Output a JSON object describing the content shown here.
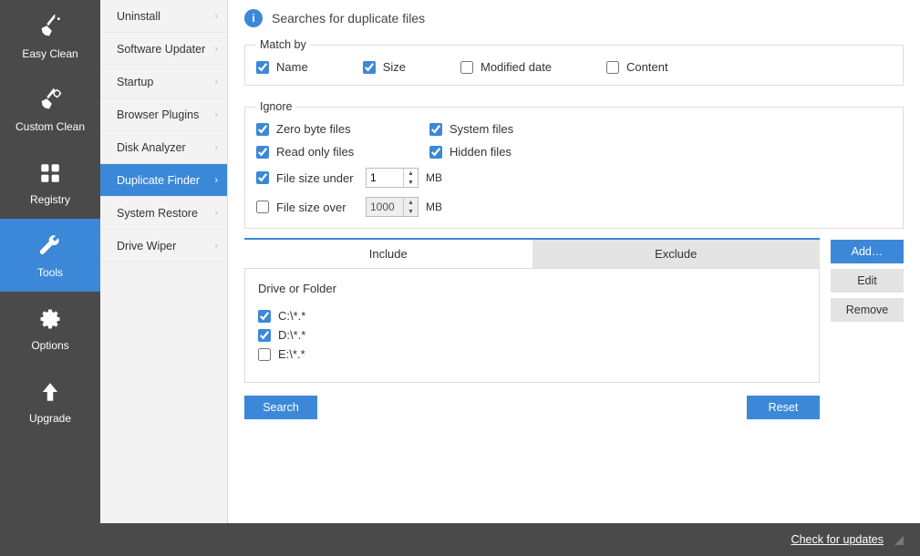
{
  "sidebar_main": {
    "items": [
      {
        "id": "easy-clean",
        "label": "Easy Clean"
      },
      {
        "id": "custom-clean",
        "label": "Custom Clean"
      },
      {
        "id": "registry",
        "label": "Registry"
      },
      {
        "id": "tools",
        "label": "Tools"
      },
      {
        "id": "options",
        "label": "Options"
      },
      {
        "id": "upgrade",
        "label": "Upgrade"
      }
    ],
    "active": "tools"
  },
  "sidebar_sub": {
    "items": [
      {
        "id": "uninstall",
        "label": "Uninstall"
      },
      {
        "id": "software-updater",
        "label": "Software Updater"
      },
      {
        "id": "startup",
        "label": "Startup"
      },
      {
        "id": "browser-plugins",
        "label": "Browser Plugins"
      },
      {
        "id": "disk-analyzer",
        "label": "Disk Analyzer"
      },
      {
        "id": "duplicate-finder",
        "label": "Duplicate Finder"
      },
      {
        "id": "system-restore",
        "label": "System Restore"
      },
      {
        "id": "drive-wiper",
        "label": "Drive Wiper"
      }
    ],
    "active": "duplicate-finder"
  },
  "header": {
    "title": "Searches for duplicate files"
  },
  "match_by": {
    "legend": "Match by",
    "options": [
      {
        "id": "name",
        "label": "Name",
        "checked": true
      },
      {
        "id": "size",
        "label": "Size",
        "checked": true
      },
      {
        "id": "modified",
        "label": "Modified date",
        "checked": false
      },
      {
        "id": "content",
        "label": "Content",
        "checked": false
      }
    ]
  },
  "ignore": {
    "legend": "Ignore",
    "zero_byte": {
      "label": "Zero byte files",
      "checked": true
    },
    "system_files": {
      "label": "System files",
      "checked": true
    },
    "read_only": {
      "label": "Read only files",
      "checked": true
    },
    "hidden_files": {
      "label": "Hidden files",
      "checked": true
    },
    "size_under": {
      "label": "File size under",
      "checked": true,
      "value": "1",
      "unit": "MB"
    },
    "size_over": {
      "label": "File size over",
      "checked": false,
      "value": "1000",
      "unit": "MB"
    }
  },
  "tabs": {
    "include_label": "Include",
    "exclude_label": "Exclude",
    "active": "include",
    "section_label": "Drive or Folder",
    "folders": [
      {
        "path": "C:\\*.*",
        "checked": true
      },
      {
        "path": "D:\\*.*",
        "checked": true
      },
      {
        "path": "E:\\*.*",
        "checked": false
      }
    ]
  },
  "actions": {
    "add": "Add…",
    "edit": "Edit",
    "remove": "Remove"
  },
  "bottom": {
    "search": "Search",
    "reset": "Reset"
  },
  "statusbar": {
    "check_updates": "Check for updates"
  }
}
